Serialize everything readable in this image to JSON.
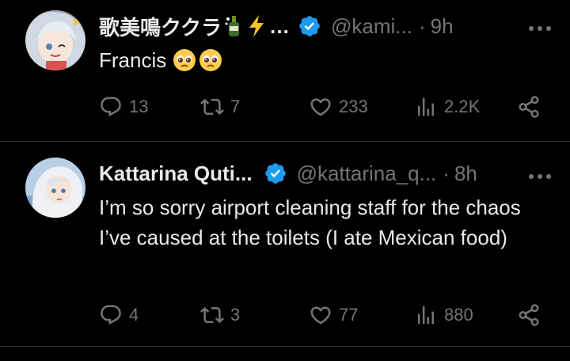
{
  "tweets": [
    {
      "display_name": "歌美鳴ククラ",
      "name_ellipsis": "…",
      "handle": "@kami...",
      "separator": "·",
      "time": "9h",
      "text": "Francis",
      "stats": {
        "replies": "13",
        "reposts": "7",
        "likes": "233",
        "views": "2.2K"
      }
    },
    {
      "display_name": "Kattarina Quti...",
      "handle": "@kattarina_q...",
      "separator": "·",
      "time": "8h",
      "text": "I’m so sorry airport cleaning staff for the chaos I’ve caused at the toilets (I ate Mexican food)",
      "stats": {
        "replies": "4",
        "reposts": "3",
        "likes": "77",
        "views": "880"
      }
    }
  ],
  "icons": [
    "verified-badge-icon",
    "more-icon",
    "reply-icon",
    "repost-icon",
    "like-icon",
    "views-icon",
    "share-icon",
    "pleading-face-emoji",
    "bottle-emoji",
    "lightning-emoji"
  ],
  "colors": {
    "background": "#000000",
    "text": "#e7e9ea",
    "muted": "#71767b",
    "verified": "#1d9bf0",
    "divider": "#2f3336"
  }
}
